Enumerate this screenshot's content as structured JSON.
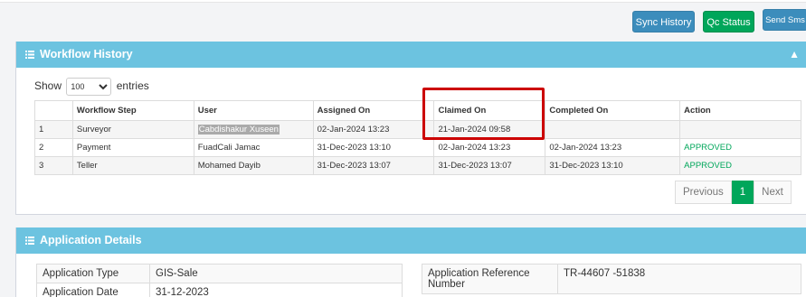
{
  "toolbar": {
    "sync_history": "Sync History",
    "qc_status": "Qc Status",
    "send_sms": "Send Sms"
  },
  "workflow": {
    "title": "Workflow History",
    "show_label": "Show",
    "entries_label": "entries",
    "page_length": "100",
    "columns": [
      "",
      "Workflow Step",
      "User",
      "Assigned On",
      "Claimed On",
      "Completed On",
      "Action"
    ],
    "rows": [
      {
        "n": "1",
        "step": "Surveyor",
        "user": "Cabdishakur Xuseen",
        "assigned": "02-Jan-2024 13:23",
        "claimed": "21-Jan-2024 09:58",
        "completed": "",
        "action": ""
      },
      {
        "n": "2",
        "step": "Payment",
        "user": "FuadCali Jamac",
        "assigned": "31-Dec-2023 13:10",
        "claimed": "02-Jan-2024 13:23",
        "completed": "02-Jan-2024 13:23",
        "action": "APPROVED"
      },
      {
        "n": "3",
        "step": "Teller",
        "user": "Mohamed Dayib",
        "assigned": "31-Dec-2023 13:07",
        "claimed": "31-Dec-2023 13:07",
        "completed": "31-Dec-2023 13:10",
        "action": "APPROVED"
      }
    ],
    "pagination": {
      "previous": "Previous",
      "current": "1",
      "next": "Next"
    }
  },
  "application": {
    "title": "Application Details",
    "left": [
      {
        "label": "Application Type",
        "value": "GIS-Sale"
      },
      {
        "label": "Application Date",
        "value": "31-12-2023"
      }
    ],
    "right": [
      {
        "label": "Application Reference Number",
        "value": "TR-44607 -51838"
      }
    ]
  },
  "colors": {
    "header": "#6cc3e0",
    "primary": "#3c8dbc",
    "success": "#00a65a",
    "annotation": "#cc0000"
  }
}
